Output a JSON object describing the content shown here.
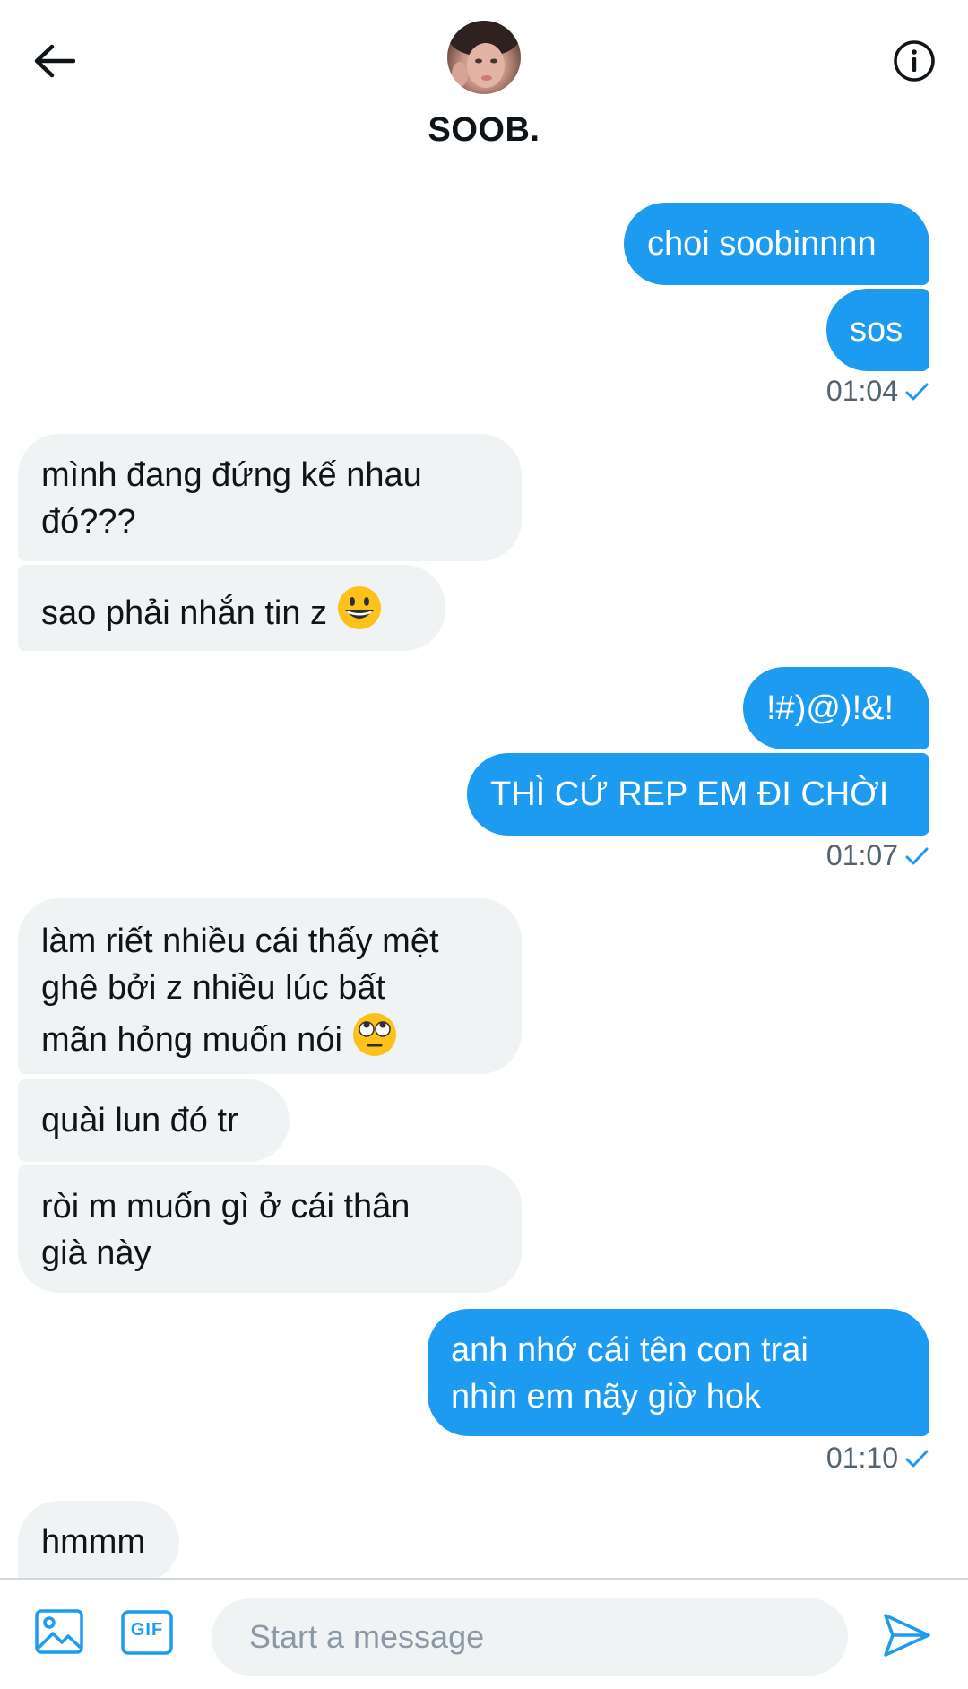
{
  "header": {
    "contact_name": "SOOB.",
    "back_icon": "arrow-left-icon",
    "info_icon": "info-icon"
  },
  "messages": [
    {
      "direction": "out",
      "text": "choi soobinnnn"
    },
    {
      "direction": "out",
      "text": "sos",
      "time": "01:04"
    },
    {
      "direction": "in",
      "text": "mình đang đứng kế nhau\nđó???"
    },
    {
      "direction": "in",
      "text": "sao phải nhắn tin z",
      "emoji": "grinning-face-emoji"
    },
    {
      "direction": "out",
      "text": "!#)@)!&!"
    },
    {
      "direction": "out",
      "text": "THÌ CỨ REP EM ĐI CHỜI",
      "time": "01:07"
    },
    {
      "direction": "in",
      "text": "làm riết nhiều cái thấy mệt\nghê bởi z nhiều lúc bất\nmãn hỏng muốn nói",
      "emoji": "eye-roll-emoji"
    },
    {
      "direction": "in",
      "text": "quài lun đó tr"
    },
    {
      "direction": "in",
      "text": "ròi m muốn gì ở cái thân\ngià này"
    },
    {
      "direction": "out",
      "text": "anh nhớ cái tên con trai\nnhìn em nãy giờ hok",
      "time": "01:10"
    },
    {
      "direction": "in",
      "text": "hmmm"
    }
  ],
  "composer": {
    "placeholder": "Start a message",
    "value": "",
    "gif_label": "GIF"
  },
  "colors": {
    "accent": "#1d9bf0",
    "incoming_bubble": "#eff3f4",
    "timestamp": "#536471"
  }
}
